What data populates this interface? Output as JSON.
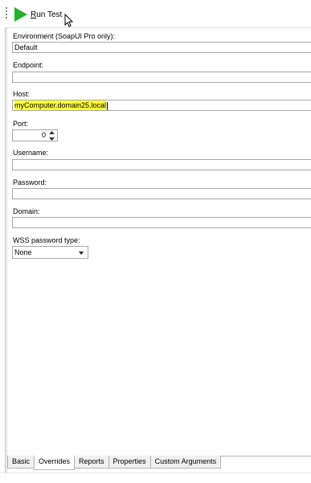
{
  "toolbar": {
    "run_label_underlined": "R",
    "run_label_rest": "un Test"
  },
  "form": {
    "environment": {
      "label": "Environment (SoapUI Pro only):",
      "value": "Default"
    },
    "endpoint": {
      "label": "Endpoint:",
      "value": ""
    },
    "host": {
      "label": "Host:",
      "value": "myComputer.domain25.local"
    },
    "port": {
      "label": "Port:",
      "value": "0"
    },
    "username": {
      "label": "Username:",
      "value": ""
    },
    "password": {
      "label": "Password:",
      "value": ""
    },
    "domain": {
      "label": "Domain:",
      "value": ""
    },
    "wss": {
      "label": "WSS password type:",
      "value": "None"
    }
  },
  "tabs": [
    {
      "label": "Basic",
      "active": false
    },
    {
      "label": "Overrides",
      "active": true
    },
    {
      "label": "Reports",
      "active": false
    },
    {
      "label": "Properties",
      "active": false
    },
    {
      "label": "Custom Arguments",
      "active": false
    }
  ],
  "colors": {
    "run_icon": "#22b32a",
    "highlight": "#ffff33"
  },
  "icons": [
    "grip-icon",
    "run-icon",
    "mouse-cursor-icon",
    "spin-up-icon",
    "spin-down-icon",
    "dropdown-arrow-icon"
  ]
}
